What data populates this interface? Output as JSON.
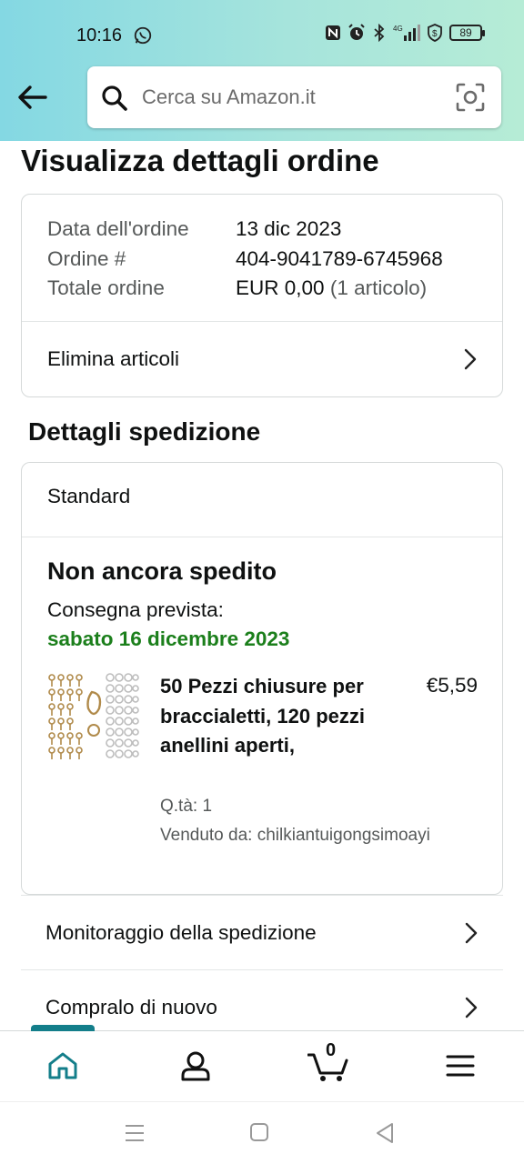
{
  "status_bar": {
    "time": "10:16",
    "battery": "89",
    "network": "4G"
  },
  "header": {
    "search_placeholder": "Cerca su Amazon.it"
  },
  "page": {
    "title": "Visualizza dettagli ordine"
  },
  "order_summary": {
    "date_label": "Data dell'ordine",
    "date_value": "13 dic 2023",
    "number_label": "Ordine #",
    "number_value": "404-9041789-6745968",
    "total_label": "Totale ordine",
    "total_value": "EUR 0,00",
    "total_items": "(1 articolo)",
    "delete_items_label": "Elimina articoli"
  },
  "shipment": {
    "section_title": "Dettagli spedizione",
    "method": "Standard",
    "status": "Non ancora spedito",
    "delivery_label": "Consegna prevista:",
    "delivery_date": "sabato 16 dicembre 2023",
    "product": {
      "title": "50 Pezzi chiusure per braccialetti, 120 pezzi anellini aperti,",
      "price": "€5,59",
      "quantity": "Q.tà: 1",
      "seller": "Venduto da: chilkiantuigongsimoayi"
    }
  },
  "actions": {
    "track_label": "Monitoraggio della spedizione",
    "buy_again_label": "Compralo di nuovo"
  },
  "bottom_nav": {
    "items": [
      "home-icon",
      "account-icon",
      "cart-icon",
      "menu-icon"
    ],
    "cart_count": "0",
    "accent_color": "#137e8a"
  },
  "colors": {
    "delivery_date": "#1b7f1b",
    "header_gradient_start": "#84d8e3",
    "header_gradient_end": "#b6ecd6"
  }
}
